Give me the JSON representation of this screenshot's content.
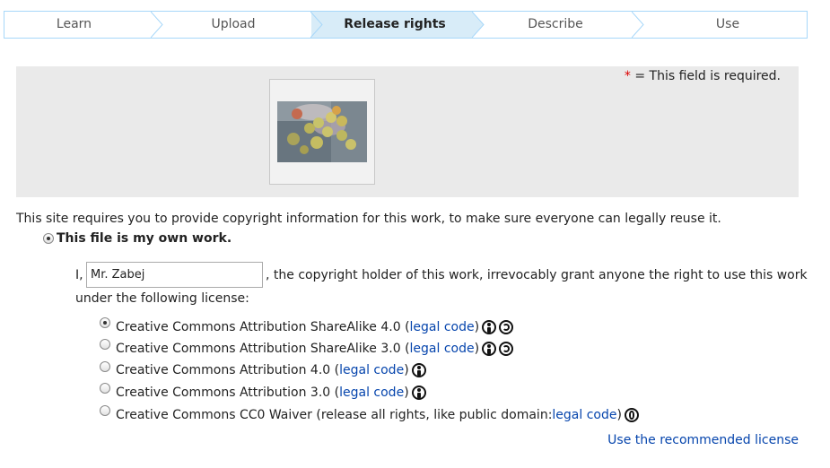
{
  "steps": [
    {
      "label": "Learn"
    },
    {
      "label": "Upload"
    },
    {
      "label": "Release rights"
    },
    {
      "label": "Describe"
    },
    {
      "label": "Use"
    }
  ],
  "panel": {
    "required_star": "*",
    "required_text": " = This field is required."
  },
  "intro": "This site requires you to provide copyright information for this work, to make sure everyone can legally reuse it.",
  "own_work_label": "This file is my own work.",
  "grant": {
    "prefix": "I,",
    "name_value": "Mr. Zabej",
    "after": ", the copyright holder of this work, irrevocably grant anyone the right to use this work",
    "line2": "under the following license:"
  },
  "licenses": [
    {
      "text": "Creative Commons Attribution ShareAlike 4.0 (",
      "link": "legal code",
      "close": ")",
      "icons": [
        "cc-by-icon",
        "cc-sa-icon"
      ],
      "checked": true
    },
    {
      "text": "Creative Commons Attribution ShareAlike 3.0 (",
      "link": "legal code",
      "close": ")",
      "icons": [
        "cc-by-icon",
        "cc-sa-icon"
      ],
      "checked": false
    },
    {
      "text": "Creative Commons Attribution 4.0 (",
      "link": "legal code",
      "close": ")",
      "icons": [
        "cc-by-icon"
      ],
      "checked": false
    },
    {
      "text": "Creative Commons Attribution 3.0 (",
      "link": "legal code",
      "close": ")",
      "icons": [
        "cc-by-icon"
      ],
      "checked": false
    },
    {
      "text": "Creative Commons CC0 Waiver (release all rights, like public domain: ",
      "link": "legal code",
      "close": ")",
      "icons": [
        "cc-zero-icon"
      ],
      "checked": false
    }
  ],
  "recommended_link": "Use the recommended license",
  "colors": {
    "link": "#0645ad",
    "active_step": "#d8ecf8",
    "step_border": "#a7d7f9",
    "panel_bg": "#eaeaea",
    "required_star": "#dd0000"
  }
}
